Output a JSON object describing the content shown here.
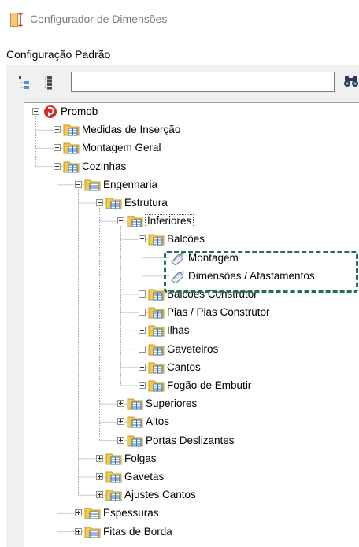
{
  "window": {
    "title": "Configurador de Dimensões",
    "app_icon": "ruler-dimension-icon"
  },
  "config_label": "Configuração Padrão",
  "toolbar": {
    "collapse_icon": "collapse-all-icon",
    "expand_icon": "expand-all-icon",
    "search_placeholder": "",
    "search_value": "",
    "search_icon": "binoculars-icon"
  },
  "tree": [
    {
      "id": "promob",
      "label": "Promob",
      "level": 0,
      "state": "expanded",
      "icon": "promob-logo-icon"
    },
    {
      "id": "medidas-insercao",
      "label": "Medidas de Inserção",
      "level": 1,
      "state": "collapsed",
      "icon": "folder-table-icon"
    },
    {
      "id": "montagem-geral",
      "label": "Montagem Geral",
      "level": 1,
      "state": "collapsed",
      "icon": "folder-table-icon"
    },
    {
      "id": "cozinhas",
      "label": "Cozinhas",
      "level": 1,
      "state": "expanded",
      "icon": "folder-table-icon"
    },
    {
      "id": "engenharia",
      "label": "Engenharia",
      "level": 2,
      "state": "expanded",
      "icon": "folder-table-icon"
    },
    {
      "id": "estrutura",
      "label": "Estrutura",
      "level": 3,
      "state": "expanded",
      "icon": "folder-table-icon"
    },
    {
      "id": "inferiores",
      "label": "Inferiores",
      "level": 4,
      "state": "expanded",
      "icon": "folder-table-icon",
      "selected": true
    },
    {
      "id": "balcoes",
      "label": "Balcões",
      "level": 5,
      "state": "expanded",
      "icon": "folder-table-icon"
    },
    {
      "id": "montagem",
      "label": "Montagem",
      "level": 6,
      "state": "leaf",
      "icon": "tag-icon"
    },
    {
      "id": "dimensoes-afastamentos",
      "label": "Dimensões / Afastamentos",
      "level": 6,
      "state": "leaf",
      "icon": "tag-icon"
    },
    {
      "id": "balcoes-construtor",
      "label": "Balcões Construtor",
      "level": 5,
      "state": "collapsed",
      "icon": "folder-table-icon"
    },
    {
      "id": "pias-construtor",
      "label": "Pias / Pias Construtor",
      "level": 5,
      "state": "collapsed",
      "icon": "folder-table-icon"
    },
    {
      "id": "ilhas",
      "label": "Ilhas",
      "level": 5,
      "state": "collapsed",
      "icon": "folder-table-icon"
    },
    {
      "id": "gaveteiros",
      "label": "Gaveteiros",
      "level": 5,
      "state": "collapsed",
      "icon": "folder-table-icon"
    },
    {
      "id": "cantos",
      "label": "Cantos",
      "level": 5,
      "state": "collapsed",
      "icon": "folder-table-icon"
    },
    {
      "id": "fogao-embutir",
      "label": "Fogão de Embutir",
      "level": 5,
      "state": "collapsed",
      "icon": "folder-table-icon"
    },
    {
      "id": "superiores",
      "label": "Superiores",
      "level": 4,
      "state": "collapsed",
      "icon": "folder-table-icon"
    },
    {
      "id": "altos",
      "label": "Altos",
      "level": 4,
      "state": "collapsed",
      "icon": "folder-table-icon"
    },
    {
      "id": "portas-deslizantes",
      "label": "Portas Deslizantes",
      "level": 4,
      "state": "collapsed",
      "icon": "folder-table-icon"
    },
    {
      "id": "folgas",
      "label": "Folgas",
      "level": 3,
      "state": "collapsed",
      "icon": "folder-table-icon"
    },
    {
      "id": "gavetas",
      "label": "Gavetas",
      "level": 3,
      "state": "collapsed",
      "icon": "folder-table-icon"
    },
    {
      "id": "ajustes-cantos",
      "label": "Ajustes Cantos",
      "level": 3,
      "state": "collapsed",
      "icon": "folder-table-icon"
    },
    {
      "id": "espessuras",
      "label": "Espessuras",
      "level": 2,
      "state": "collapsed",
      "icon": "folder-table-icon"
    },
    {
      "id": "fitas-borda",
      "label": "Fitas de Borda",
      "level": 2,
      "state": "collapsed",
      "icon": "folder-table-icon"
    }
  ],
  "annotation": {
    "color": "#1f6f5a",
    "style": "dashed"
  }
}
